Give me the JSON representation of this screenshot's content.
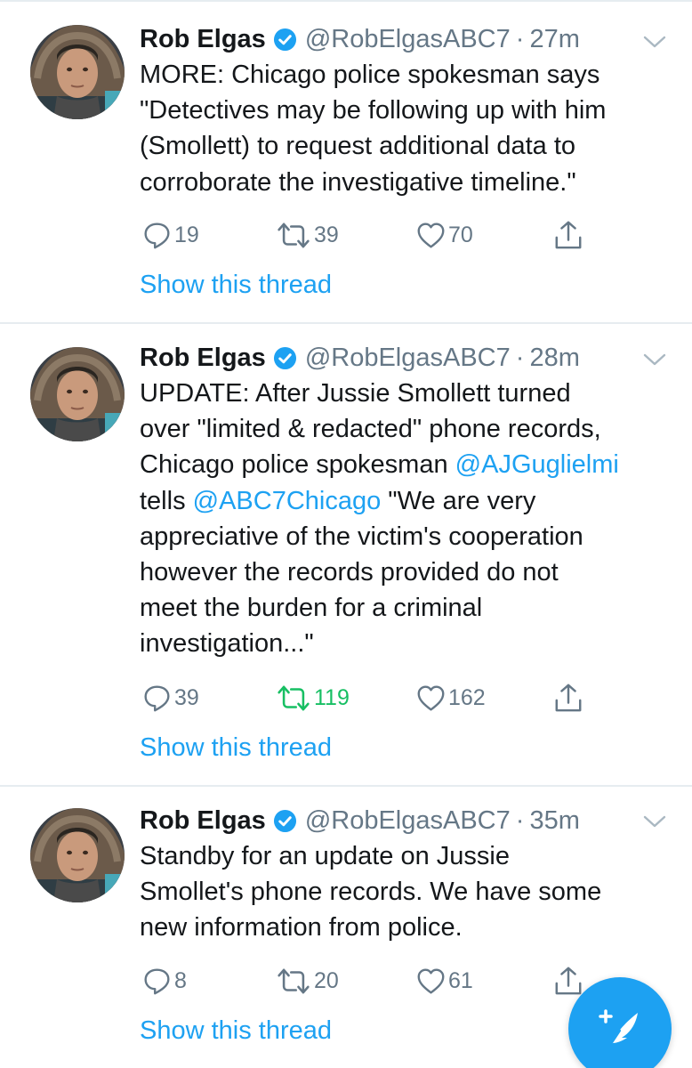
{
  "colors": {
    "accent": "#1da1f2",
    "retweet_active": "#17bf63",
    "secondary_text": "#657786",
    "divider": "#e6ecf0"
  },
  "tweets": [
    {
      "name": "Rob Elgas",
      "handle": "@RobElgasABC7",
      "separator": "·",
      "time": "27m",
      "text": {
        "l1": "MORE: Chicago police spokesman says",
        "l2": "\"Detectives may be following up with him",
        "l3": "(Smollett) to request additional data to",
        "l4": "corroborate the investigative timeline.\""
      },
      "replies": "19",
      "retweets": "39",
      "likes": "70",
      "retweeted": false,
      "show_thread": "Show this thread"
    },
    {
      "name": "Rob Elgas",
      "handle": "@RobElgasABC7",
      "separator": "·",
      "time": "28m",
      "text": {
        "l1": "UPDATE: After Jussie Smollett turned",
        "l2": "over \"limited & redacted\" phone records,",
        "l3_prefix": "Chicago police spokesman ",
        "l3_mention": "@AJGuglielmi",
        "l4_prefix": "tells ",
        "l4_mention": "@ABC7Chicago",
        "l4_suffix": " \"We are very",
        "l5": "appreciative of the victim's cooperation",
        "l6": "however the records provided do not",
        "l7": "meet the burden for a criminal",
        "l8": "investigation...\""
      },
      "replies": "39",
      "retweets": "119",
      "likes": "162",
      "retweeted": true,
      "show_thread": "Show this thread"
    },
    {
      "name": "Rob Elgas",
      "handle": "@RobElgasABC7",
      "separator": "·",
      "time": "35m",
      "text": {
        "l1": "Standby for an update on Jussie",
        "l2": "Smollet's phone records. We have some",
        "l3": "new information from police."
      },
      "replies": "8",
      "retweets": "20",
      "likes": "61",
      "retweeted": false,
      "show_thread": "Show this thread"
    }
  ],
  "icons": {
    "reply": "reply-icon",
    "retweet": "retweet-icon",
    "like": "heart-icon",
    "share": "share-icon",
    "caret": "chevron-down-icon",
    "verified": "verified-badge-icon",
    "compose": "compose-tweet-icon"
  }
}
